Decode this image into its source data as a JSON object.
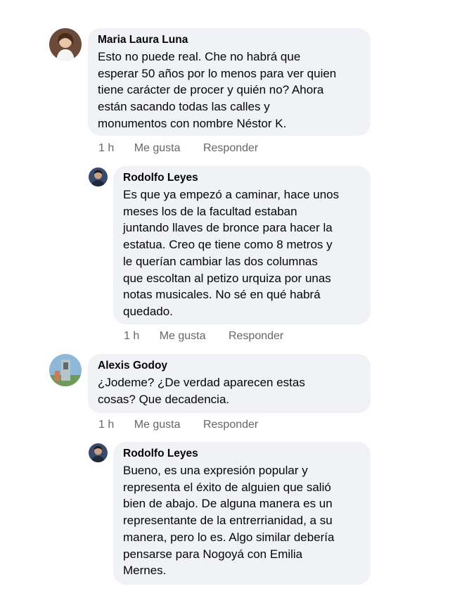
{
  "comments": [
    {
      "author": "Maria Laura Luna",
      "lines": [
        "Esto no puede real. Che no habrá que",
        "esperar 50 años por lo menos para ver quien",
        "tiene carácter de procer y quién no? Ahora",
        "están sacando todas las calles y",
        "monumentos con nombre Néstor K."
      ],
      "time": "1 h",
      "like": "Me gusta",
      "reply": "Responder"
    },
    {
      "author": "Rodolfo Leyes",
      "lines": [
        "Es que ya empezó a caminar, hace unos",
        "meses los de la facultad estaban",
        "juntando llaves de bronce para hacer la",
        "estatua. Creo qe tiene como 8 metros y",
        "le querían cambiar las dos columnas",
        "que escoltan al petizo urquiza por unas",
        "notas musicales. No sé en qué habrá",
        "quedado."
      ],
      "time": "1 h",
      "like": "Me gusta",
      "reply": "Responder"
    },
    {
      "author": "Alexis Godoy",
      "lines": [
        "¿Jodeme? ¿De verdad aparecen estas",
        "cosas? Que decadencia."
      ],
      "time": "1 h",
      "like": "Me gusta",
      "reply": "Responder"
    },
    {
      "author": "Rodolfo Leyes",
      "lines": [
        "Bueno, es una expresión popular y",
        "representa el éxito de alguien que salió",
        "bien de abajo. De alguna manera es un",
        "representante de la entrerrianidad, a su",
        "manera, pero lo es. Algo similar debería",
        "pensarse para Nogoyá con Emilia",
        "Mernes."
      ]
    }
  ],
  "colors": {
    "bubble": "#f0f2f5",
    "text": "#050505",
    "meta": "#65676b"
  }
}
